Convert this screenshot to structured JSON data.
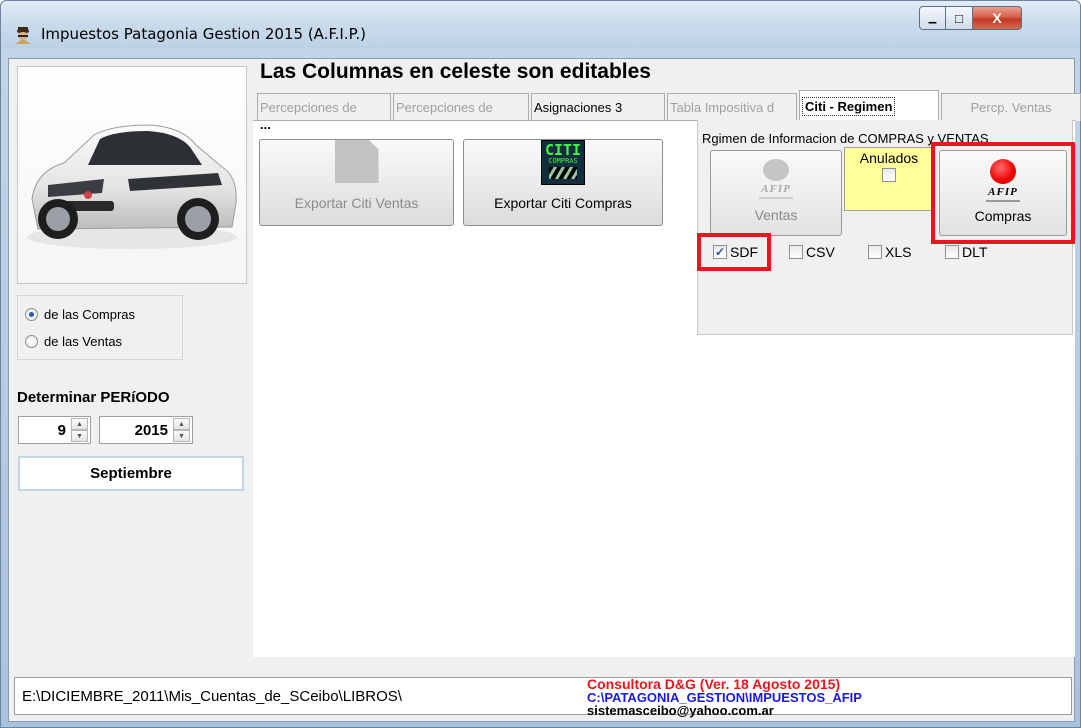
{
  "window": {
    "title": "Impuestos Patagonia Gestion 2015 (A.F.I.P.)",
    "min_label": "▁",
    "max_label": "□",
    "close_label": "X"
  },
  "left": {
    "radio_compras": "de las Compras",
    "radio_ventas": "de las Ventas",
    "selected_radio": "de las Compras",
    "period_title": "Determinar PERíODO",
    "month_value": "9",
    "year_value": "2015",
    "month_name": "Septiembre"
  },
  "main": {
    "heading": "Las Columnas en celeste son editables",
    "tabs": [
      {
        "label": "Percepciones de"
      },
      {
        "label": "Percepciones de"
      },
      {
        "label": "Asignaciones 3"
      },
      {
        "label": "Tabla Impositiva d"
      },
      {
        "label": "Citi - Regimen"
      },
      {
        "label": "Percp. Ventas"
      }
    ],
    "ellipsis": "...",
    "btn_export_ventas": "Exportar Citi Ventas",
    "btn_export_compras": "Exportar Citi Compras",
    "citi_icon_text": "CITI",
    "citi_icon_sub": "COMPRAS"
  },
  "regimen": {
    "title": "Rgimen de Informacion de COMPRAS y VENTAS",
    "ventas_label": "Ventas",
    "compras_label": "Compras",
    "afip_logo": "AFIP",
    "anulados_label": "Anulados",
    "anulados_checked": false,
    "formats": [
      {
        "label": "SDF",
        "checked": true
      },
      {
        "label": "CSV",
        "checked": false
      },
      {
        "label": "XLS",
        "checked": false
      },
      {
        "label": "DLT",
        "checked": false
      }
    ]
  },
  "status": {
    "path": "E:\\DICIEMBRE_2011\\Mis_Cuentas_de_SCeibo\\LIBROS\\",
    "line1": "Consultora D&G (Ver. 18 Agosto 2015)",
    "line2": "C:\\PATAGONIA_GESTION\\IMPUESTOS_AFIP",
    "line3": "sistemasceibo@yahoo.com.ar"
  },
  "colors": {
    "highlight_red": "#e8171f",
    "anulados_bg": "#ffff99",
    "status_red": "#e8171f",
    "status_blue": "#1a1add"
  }
}
